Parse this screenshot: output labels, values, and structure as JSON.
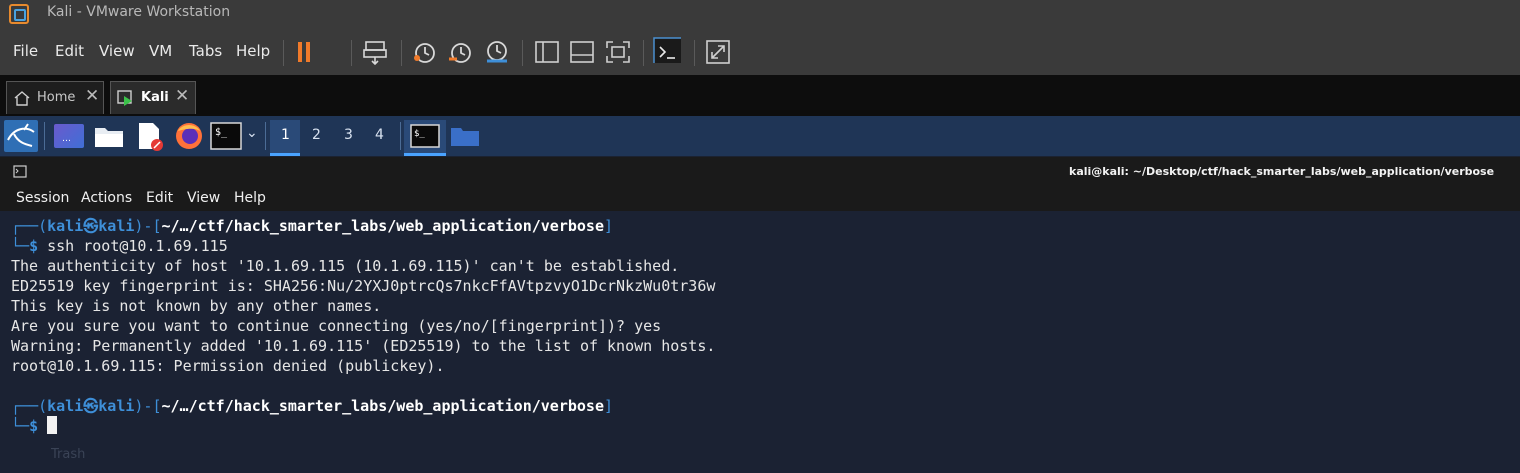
{
  "window": {
    "title": "Kali - VMware Workstation"
  },
  "menu": [
    "File",
    "Edit",
    "View",
    "VM",
    "Tabs",
    "Help"
  ],
  "tabs": [
    {
      "label": "Home"
    },
    {
      "label": "Kali"
    }
  ],
  "workspaces": [
    "1",
    "2",
    "3",
    "4"
  ],
  "terminal": {
    "title": "kali@kali: ~/Desktop/ctf/hack_smarter_labs/web_application/verbose",
    "menu": [
      "Session",
      "Actions",
      "Edit",
      "View",
      "Help"
    ],
    "prompt": {
      "user": "kali",
      "host": "kali",
      "path": "~/…/ctf/hack_smarter_labs/web_application/verbose"
    },
    "command": "ssh root@10.1.69.115",
    "output": [
      "The authenticity of host '10.1.69.115 (10.1.69.115)' can't be established.",
      "ED25519 key fingerprint is: SHA256:Nu/2YXJ0ptrcQs7nkcFfAVtpzvyO1DcrNkzWu0tr36w",
      "This key is not known by any other names.",
      "Are you sure you want to continue connecting (yes/no/[fingerprint])? yes",
      "Warning: Permanently added '10.1.69.115' (ED25519) to the list of known hosts.",
      "root@10.1.69.115: Permission denied (publickey)."
    ]
  },
  "desktop": {
    "trash_label": "Trash"
  },
  "colors": {
    "accent": "#3e8fd8",
    "panel": "#1f3556"
  }
}
